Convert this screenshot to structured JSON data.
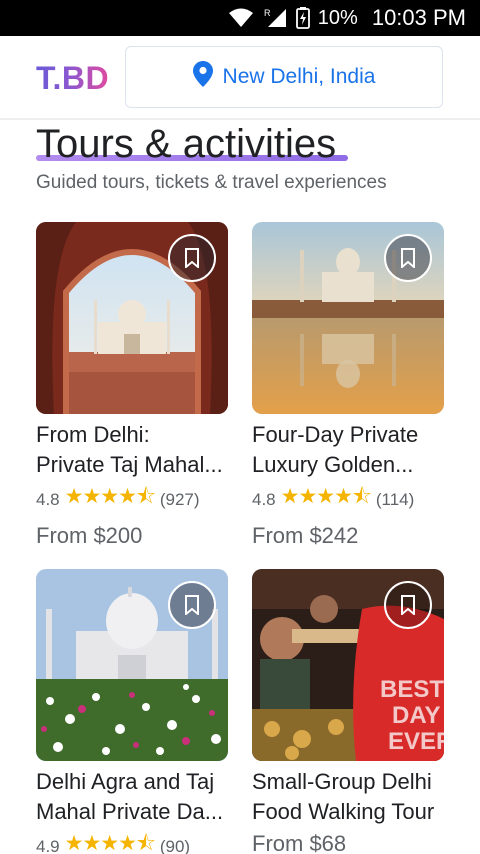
{
  "status_bar": {
    "battery": "10%",
    "time": "10:03 PM",
    "icons": [
      "wifi-icon",
      "signal-icon",
      "battery-charging-icon"
    ],
    "roaming": "R"
  },
  "header": {
    "logo": "T.BD",
    "location": "New Delhi, India",
    "location_icon": "location-pin-icon"
  },
  "section": {
    "title": "Tours & activities",
    "subtitle": "Guided tours, tickets & travel experiences"
  },
  "cards": [
    {
      "title_line1": "From Delhi:",
      "title_line2": "Private Taj Mahal...",
      "rating": "4.8",
      "stars": "★★★★⯪",
      "reviews": "(927)",
      "price": "From $200"
    },
    {
      "title_line1": "Four-Day Private",
      "title_line2": "Luxury Golden...",
      "rating": "4.8",
      "stars": "★★★★⯪",
      "reviews": "(114)",
      "price": "From $242"
    },
    {
      "title_line1": "Delhi Agra and Taj",
      "title_line2": "Mahal Private Da...",
      "rating": "4.9",
      "stars": "★★★★⯪",
      "reviews": "(90)",
      "price": ""
    },
    {
      "title_line1": "Small-Group Delhi",
      "title_line2": "Food Walking Tour",
      "rating": "",
      "stars": "",
      "reviews": "",
      "price": "From $68"
    }
  ],
  "colors": {
    "accent": "#1a73e8",
    "star": "#f4b400",
    "logo_gradient_start": "#6b5bd6",
    "logo_gradient_end": "#e04aa0"
  }
}
